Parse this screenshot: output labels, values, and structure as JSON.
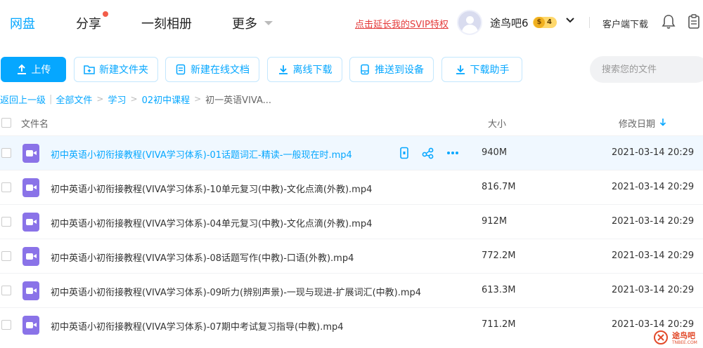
{
  "nav": {
    "tabs": [
      "网盘",
      "分享",
      "一刻相册",
      "更多"
    ],
    "svip_promo": "点击延长我的SVIP特权",
    "username": "途鸟吧6",
    "vip_level": "4",
    "client_download": "客户端下载"
  },
  "toolbar": {
    "upload": "上传",
    "new_folder": "新建文件夹",
    "new_online_doc": "新建在线文档",
    "offline_download": "离线下载",
    "push_to_device": "推送到设备",
    "download_helper": "下载助手",
    "search_placeholder": "搜索您的文件"
  },
  "breadcrumb": {
    "back": "返回上一级",
    "separator": "|",
    "items": [
      "全部文件",
      "学习",
      "02初中课程",
      "初一英语VIVA..."
    ]
  },
  "table": {
    "headers": {
      "name": "文件名",
      "size": "大小",
      "modified": "修改日期"
    },
    "rows": [
      {
        "name": "初中英语小初衔接教程(VIVA学习体系)-01话题词汇-精读-一般现在时.mp4",
        "size": "940M",
        "date": "2021-03-14 20:29"
      },
      {
        "name": "初中英语小初衔接教程(VIVA学习体系)-10单元复习(中教)-文化点滴(外教).mp4",
        "size": "816.7M",
        "date": "2021-03-14 20:29"
      },
      {
        "name": "初中英语小初衔接教程(VIVA学习体系)-04单元复习(中教)-文化点滴(外教).mp4",
        "size": "912M",
        "date": "2021-03-14 20:29"
      },
      {
        "name": "初中英语小初衔接教程(VIVA学习体系)-08话题写作(中教)-口语(外教).mp4",
        "size": "772.2M",
        "date": "2021-03-14 20:29"
      },
      {
        "name": "初中英语小初衔接教程(VIVA学习体系)-09听力(辨别声景)-一现与现进-扩展词汇(中教).mp4",
        "size": "613.3M",
        "date": "2021-03-14 20:29"
      },
      {
        "name": "初中英语小初衔接教程(VIVA学习体系)-07期中考试复习指导(中教).mp4",
        "size": "711.2M",
        "date": "2021-03-14 20:29"
      }
    ]
  },
  "watermark": {
    "text": "途鸟吧",
    "sub": "TNBEE.COM"
  },
  "colors": {
    "accent": "#06a7ff",
    "promo": "#e43b3b",
    "video_icon": "#8a73e8",
    "hover_row": "#f0f8ff"
  }
}
